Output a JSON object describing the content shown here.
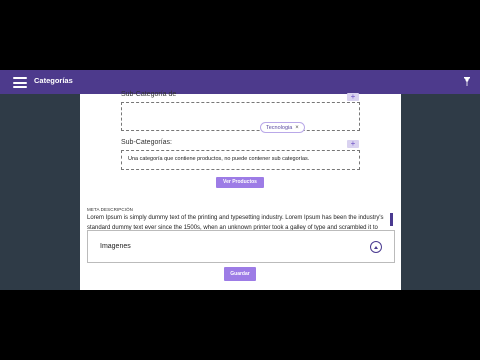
{
  "app_bar": {
    "title": "Categorías"
  },
  "form": {
    "subcategory_of": {
      "label": "Sub-Categoría de",
      "add_label": "+",
      "chips": [
        {
          "label": "Tecnologia",
          "remove": "×"
        }
      ]
    },
    "subcategories": {
      "label": "Sub-Categorías:",
      "add_label": "+",
      "description": "Una categoría que contiene productos, no puede contener sub categorías."
    },
    "view_products_button": "Ver Productos",
    "meta": {
      "label": "META DESCRIPCIÓN",
      "text": "Lorem Ipsum is simply dummy text of the printing and typesetting industry. Lorem Ipsum has been the industry's standard dummy text ever since the 1500s, when an unknown printer took a galley of type and scrambled it to make a type"
    },
    "images": {
      "label": "Imagenes"
    },
    "save_button": "Guardar"
  },
  "colors": {
    "app_bar": "#4d3a8c",
    "button": "#9d7ce6",
    "page_background": "#2f3b47"
  }
}
